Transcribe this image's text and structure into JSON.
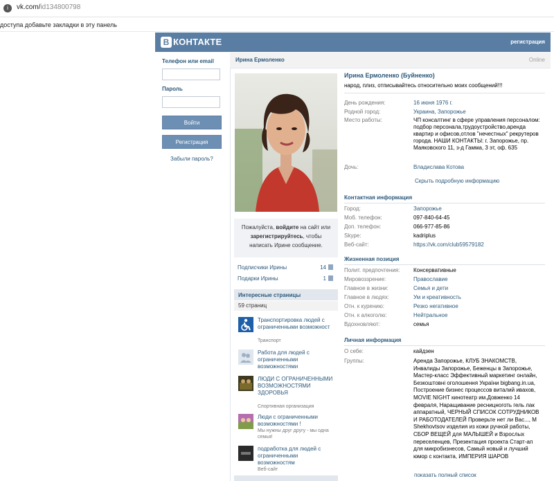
{
  "browser": {
    "url_host": "vk.com/",
    "url_path": "id134800798",
    "bookmarks_hint": "доступа добавьте закладки в эту панель"
  },
  "header": {
    "logo_letter": "B",
    "logo_text": "КОНТАКТЕ",
    "register_link": "регистрация"
  },
  "login": {
    "phone_label": "Телефон или email",
    "password_label": "Пароль",
    "login_button": "Войти",
    "register_button": "Регистрация",
    "forgot_link": "Забыли пароль?"
  },
  "profile": {
    "name_bar": "Ирина Ермоленко",
    "online": "Online",
    "full_name": "Ирина Ермоленко (Буйненко)",
    "status": "народ, плиз, отписывайтесь относительно моих сообщений!!!"
  },
  "invite": {
    "line1_pre": "Пожалуйста, ",
    "line1_bold": "войдите",
    "line1_post": " на сайт или",
    "line2_bold": "зарегистрируйтесь",
    "line2_post": ", чтобы",
    "line3": "написать Ирине сообщение."
  },
  "stats": [
    {
      "label": "Подписчики Ирины",
      "count": "14"
    },
    {
      "label": "Подарки Ирины",
      "count": "1"
    }
  ],
  "interesting": {
    "title": "Интересные страницы",
    "count": "59 страниц",
    "pages": [
      {
        "title": "Транспортировка людей с ограниченными возможност",
        "subtitle": "Транспорт",
        "icon": "wheelchair-icon"
      },
      {
        "title": "Работа для людей с ограниченными возможностями",
        "subtitle": "",
        "icon": "people-icon"
      },
      {
        "title": "ЛЮДИ С ОГРАНИЧЕННЫМИ ВОЗМОЖНОСТЯМИ ЗДОРОВЬЯ",
        "subtitle": "Спортивная организация",
        "icon": "sport-photo"
      },
      {
        "title": "Люди с ограниченными возможностями !",
        "subtitle": "Мы нужны друг другу - мы одна семья!",
        "icon": "group-photo"
      },
      {
        "title": "подработка для людей с ограниченными возможностям",
        "subtitle": "Веб-сайт",
        "icon": "dark-logo"
      }
    ]
  },
  "basic_info": [
    {
      "key": "День рождения:",
      "value": "16 июня 1976 г."
    },
    {
      "key": "Родной город:",
      "value": "Украина, Запорожье"
    },
    {
      "key": "Место работы:",
      "value": "ЧП консалтинг в сфере управления персоналом: подбор персонала,трудоустройство,аренда квартир и офисов,отлов \"нечестных\" рекрутеров города. НАШИ КОНТАКТЫ: г. Запорожье, пр. Маяковского 11, з-д Гамма, 3 эт, оф. 635"
    },
    {
      "key": "Дочь:",
      "value": "Владислава Котова"
    }
  ],
  "show_details": "Скрыть подробную информацию",
  "contacts": {
    "title": "Контактная информация",
    "rows": [
      {
        "key": "Город:",
        "value": "Запорожье"
      },
      {
        "key": "Моб. телефон:",
        "value": "097-840-64-45"
      },
      {
        "key": "Доп. телефон:",
        "value": "066-977-85-86"
      },
      {
        "key": "Skype:",
        "value": "kadriplus"
      },
      {
        "key": "Веб-сайт:",
        "value": "https://vk.com/club59579182"
      }
    ]
  },
  "position": {
    "title": "Жизненная позиция",
    "rows": [
      {
        "key": "Полит. предпочтения:",
        "value": "Консервативные"
      },
      {
        "key": "Мировоззрение:",
        "value": "Православие"
      },
      {
        "key": "Главное в жизни:",
        "value": "Семья и дети"
      },
      {
        "key": "Главное в людях:",
        "value": "Ум и креативность"
      },
      {
        "key": "Отн. к курению:",
        "value": "Резко негативное"
      },
      {
        "key": "Отн. к алкоголю:",
        "value": "Нейтральное"
      },
      {
        "key": "Вдохновляют:",
        "value": "семья"
      }
    ]
  },
  "personal": {
    "title": "Личная информация",
    "about_key": "О себе:",
    "about_value": "кайдзен",
    "groups_key": "Группы:",
    "groups_value": "Аренда Запорожье, КЛУБ ЗНАКОМСТВ, Инвалиды Запорожье, Беженцы в Запорожье, Мастер-класс Эффективный маркетинг онлайн, Безкоштовні оголошення України bigbang.in.ua, Построение бизнес процессов виталий ивахов, MOVIE NIGHT кинотеатр им.Довженко 14 февраля, Наращивание ресницноготь гель лак аппаратный, ЧЕРНЫЙ СПИСОК СОТРУДНИКОВ И РАБОТОДАТЕЛЕЙ Проверьте нет ли Вас..., М Shekhovtsov изделия из кожи ручной работы, СБОР ВЕЩЕЙ для МАЛЫШЕЙ и Взрослых переселенцев, Презентация проекта Старт-ап для микробизнесов, Самый новый и лучший юмор с контакта, ИМПЕРИЯ ШАРОВ",
    "show_full_list": "показать полный список"
  },
  "colors": {
    "header_blue": "#597da3",
    "link_blue": "#2b587a",
    "button_blue": "#6d8fb3"
  }
}
